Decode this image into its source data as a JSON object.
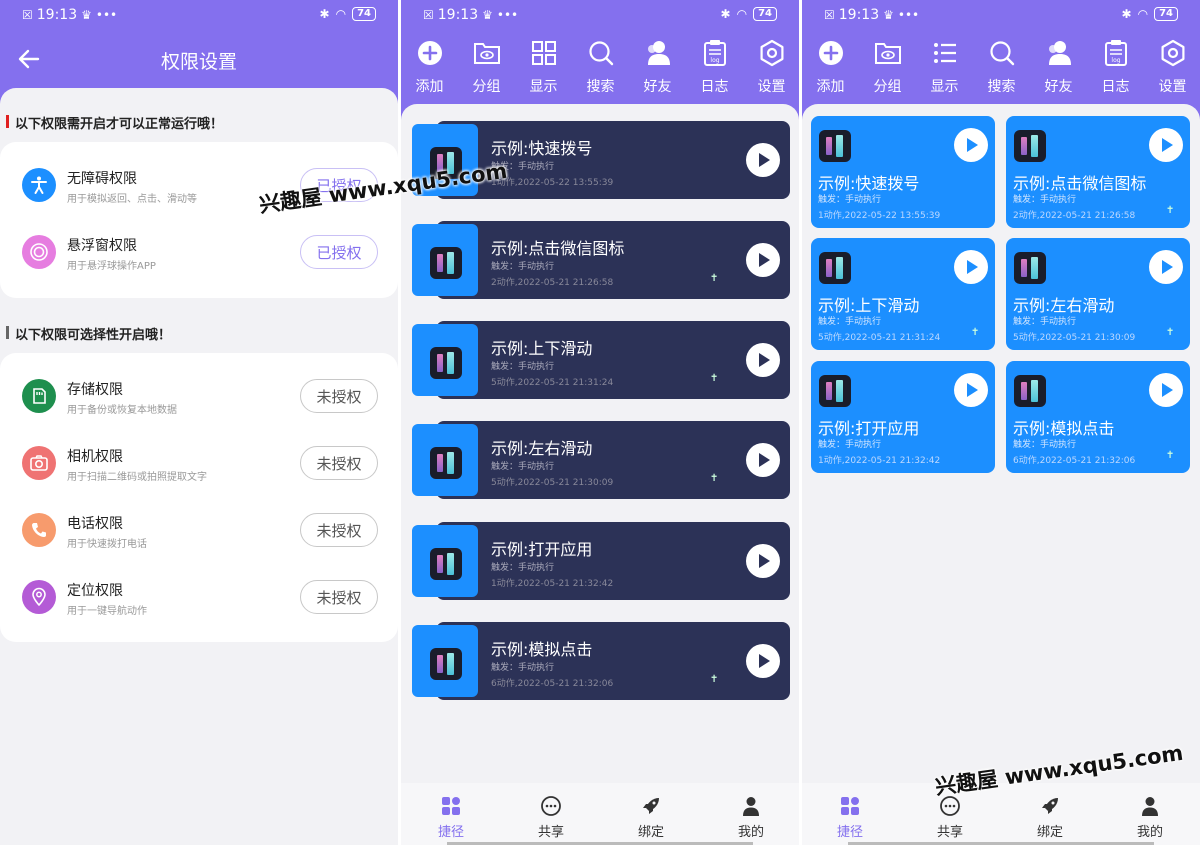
{
  "status_bar": {
    "time": "19:13",
    "battery": "74"
  },
  "permission_screen": {
    "title": "权限设置",
    "required_section": "以下权限需开启才可以正常运行哦！",
    "optional_section": "以下权限可选择性开启哦！",
    "required": [
      {
        "name": "无障碍权限",
        "desc": "用于模拟返回、点击、滑动等",
        "button": "已授权",
        "icon": "accessibility-icon",
        "color": "#1c8fff"
      },
      {
        "name": "悬浮窗权限",
        "desc": "用于悬浮球操作APP",
        "button": "已授权",
        "icon": "floating-window-icon",
        "color": "#e67de0"
      }
    ],
    "optional": [
      {
        "name": "存储权限",
        "desc": "用于备份或恢复本地数据",
        "button": "未授权",
        "icon": "storage-icon",
        "color": "#1e8f4e"
      },
      {
        "name": "相机权限",
        "desc": "用于扫描二维码或拍照提取文字",
        "button": "未授权",
        "icon": "camera-icon",
        "color": "#ef7373"
      },
      {
        "name": "电话权限",
        "desc": "用于快速拨打电话",
        "button": "未授权",
        "icon": "phone-icon",
        "color": "#f79b6d"
      },
      {
        "name": "定位权限",
        "desc": "用于一键导航动作",
        "button": "未授权",
        "icon": "location-icon",
        "color": "#b45bd6"
      }
    ]
  },
  "toolbar": [
    {
      "label": "添加",
      "icon": "add-icon"
    },
    {
      "label": "分组",
      "icon": "group-folder-icon"
    },
    {
      "label": "显示",
      "icon": "display-grid-icon"
    },
    {
      "label": "搜索",
      "icon": "search-icon"
    },
    {
      "label": "好友",
      "icon": "friends-icon"
    },
    {
      "label": "日志",
      "icon": "log-icon"
    },
    {
      "label": "设置",
      "icon": "settings-icon"
    }
  ],
  "toolbar_grid_view": [
    {
      "label": "添加",
      "icon": "add-icon"
    },
    {
      "label": "分组",
      "icon": "group-folder-icon"
    },
    {
      "label": "显示",
      "icon": "display-list-icon"
    },
    {
      "label": "搜索",
      "icon": "search-icon"
    },
    {
      "label": "好友",
      "icon": "friends-icon"
    },
    {
      "label": "日志",
      "icon": "log-icon"
    },
    {
      "label": "设置",
      "icon": "settings-icon"
    }
  ],
  "shortcuts": [
    {
      "name": "示例:快速拨号",
      "trigger": "触发：手动执行",
      "meta": "1动作,2022-05-22 13:55:39",
      "badge": false
    },
    {
      "name": "示例:点击微信图标",
      "trigger": "触发：手动执行",
      "meta": "2动作,2022-05-21 21:26:58",
      "badge": true
    },
    {
      "name": "示例:上下滑动",
      "trigger": "触发：手动执行",
      "meta": "5动作,2022-05-21 21:31:24",
      "badge": true
    },
    {
      "name": "示例:左右滑动",
      "trigger": "触发：手动执行",
      "meta": "5动作,2022-05-21 21:30:09",
      "badge": true
    },
    {
      "name": "示例:打开应用",
      "trigger": "触发：手动执行",
      "meta": "1动作,2022-05-21 21:32:42",
      "badge": false
    },
    {
      "name": "示例:模拟点击",
      "trigger": "触发：手动执行",
      "meta": "6动作,2022-05-21 21:32:06",
      "badge": true
    }
  ],
  "bottom_nav": [
    {
      "label": "捷径",
      "icon": "shortcuts-icon",
      "active": true
    },
    {
      "label": "共享",
      "icon": "share-chat-icon",
      "active": false
    },
    {
      "label": "绑定",
      "icon": "rocket-icon",
      "active": false
    },
    {
      "label": "我的",
      "icon": "profile-icon",
      "active": false
    }
  ],
  "watermark": "兴趣屋 www.xqu5.com",
  "colors": {
    "primary": "#8470ee",
    "card_dark": "#2c3257",
    "card_blue": "#1c8fff",
    "background": "#f2f2f5"
  }
}
